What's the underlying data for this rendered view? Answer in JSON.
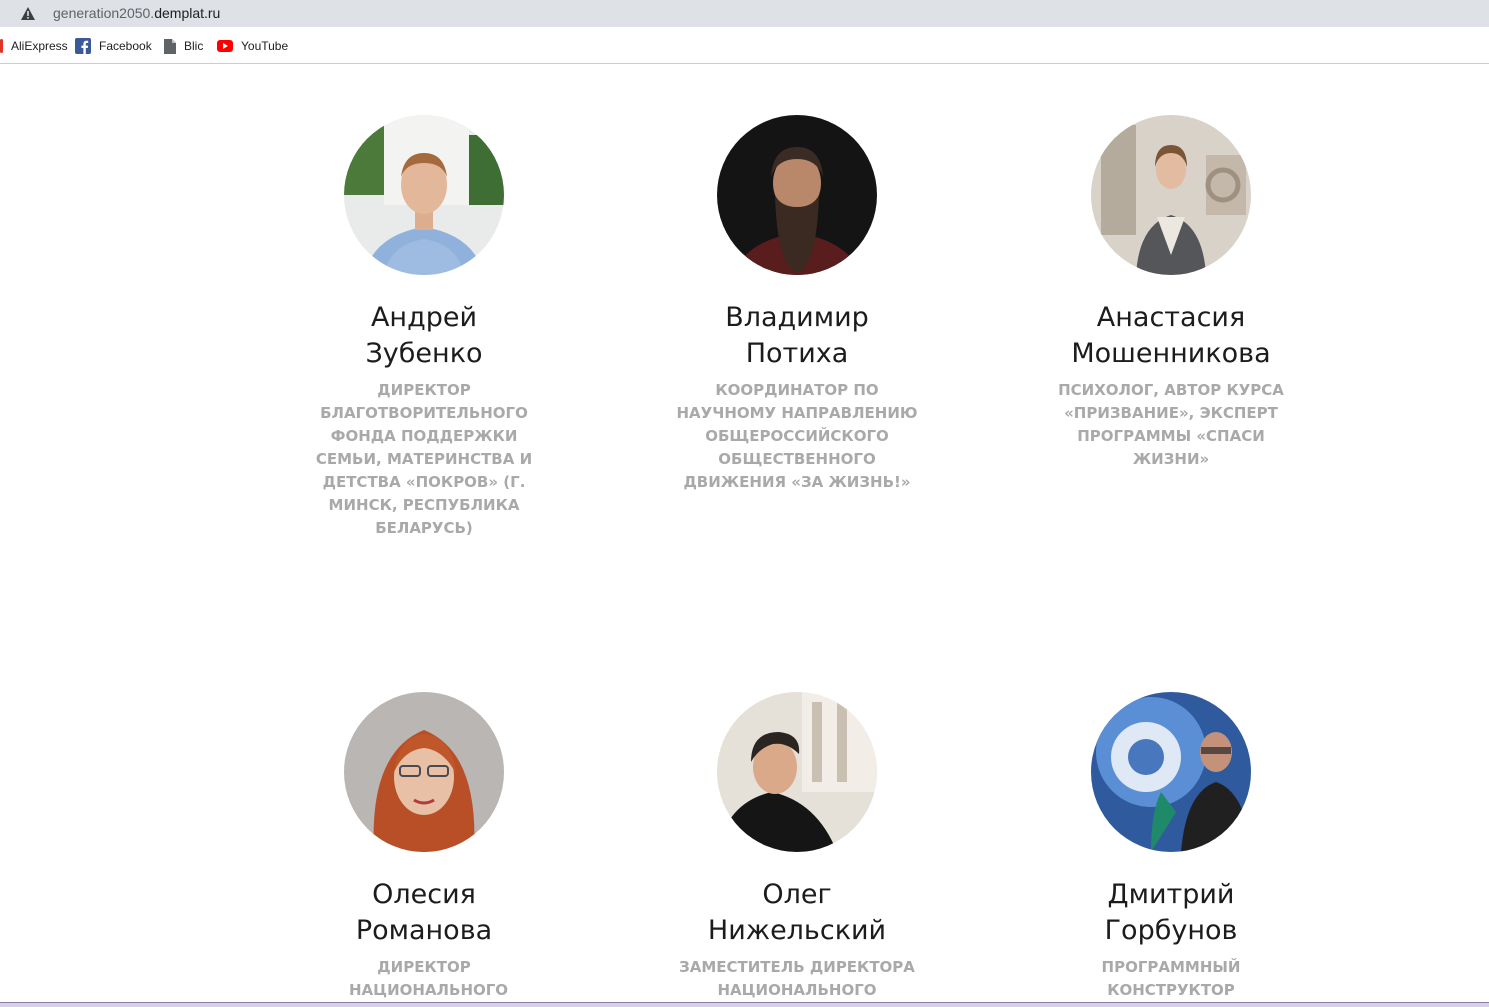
{
  "browser": {
    "url_path": "generation2050.",
    "url_host": "demplat.ru",
    "bookmarks": [
      {
        "label": "AliExpress",
        "icon": "aliexpress-icon"
      },
      {
        "label": "Facebook",
        "icon": "facebook-icon"
      },
      {
        "label": "Blic",
        "icon": "document-icon"
      },
      {
        "label": "YouTube",
        "icon": "youtube-icon"
      }
    ]
  },
  "people": [
    {
      "first": "Андрей",
      "last": "Зубенко",
      "role": "Директор благотворительного фонда поддержки семьи, материнства и детства «Покров» (г. Минск, Республика Беларусь)"
    },
    {
      "first": "Владимир",
      "last": "Потиха",
      "role": "Координатор по научному направлению Общероссийского общественного движения «За жизнь!»"
    },
    {
      "first": "Анастасия",
      "last": "Мошенникова",
      "role": "Психолог, автор курса «Призвание», эксперт программы «Спаси жизни»"
    },
    {
      "first": "Олесия",
      "last": "Романова",
      "role": "Директор национального"
    },
    {
      "first": "Олег",
      "last": "Нижельский",
      "role": "Заместитель директора национального"
    },
    {
      "first": "Дмитрий",
      "last": "Горбунов",
      "role": "Программный конструктор"
    }
  ],
  "colors": {
    "name": "#1c1c1c",
    "role": "#a9a9a9",
    "addressbar": "#dee1e6"
  }
}
